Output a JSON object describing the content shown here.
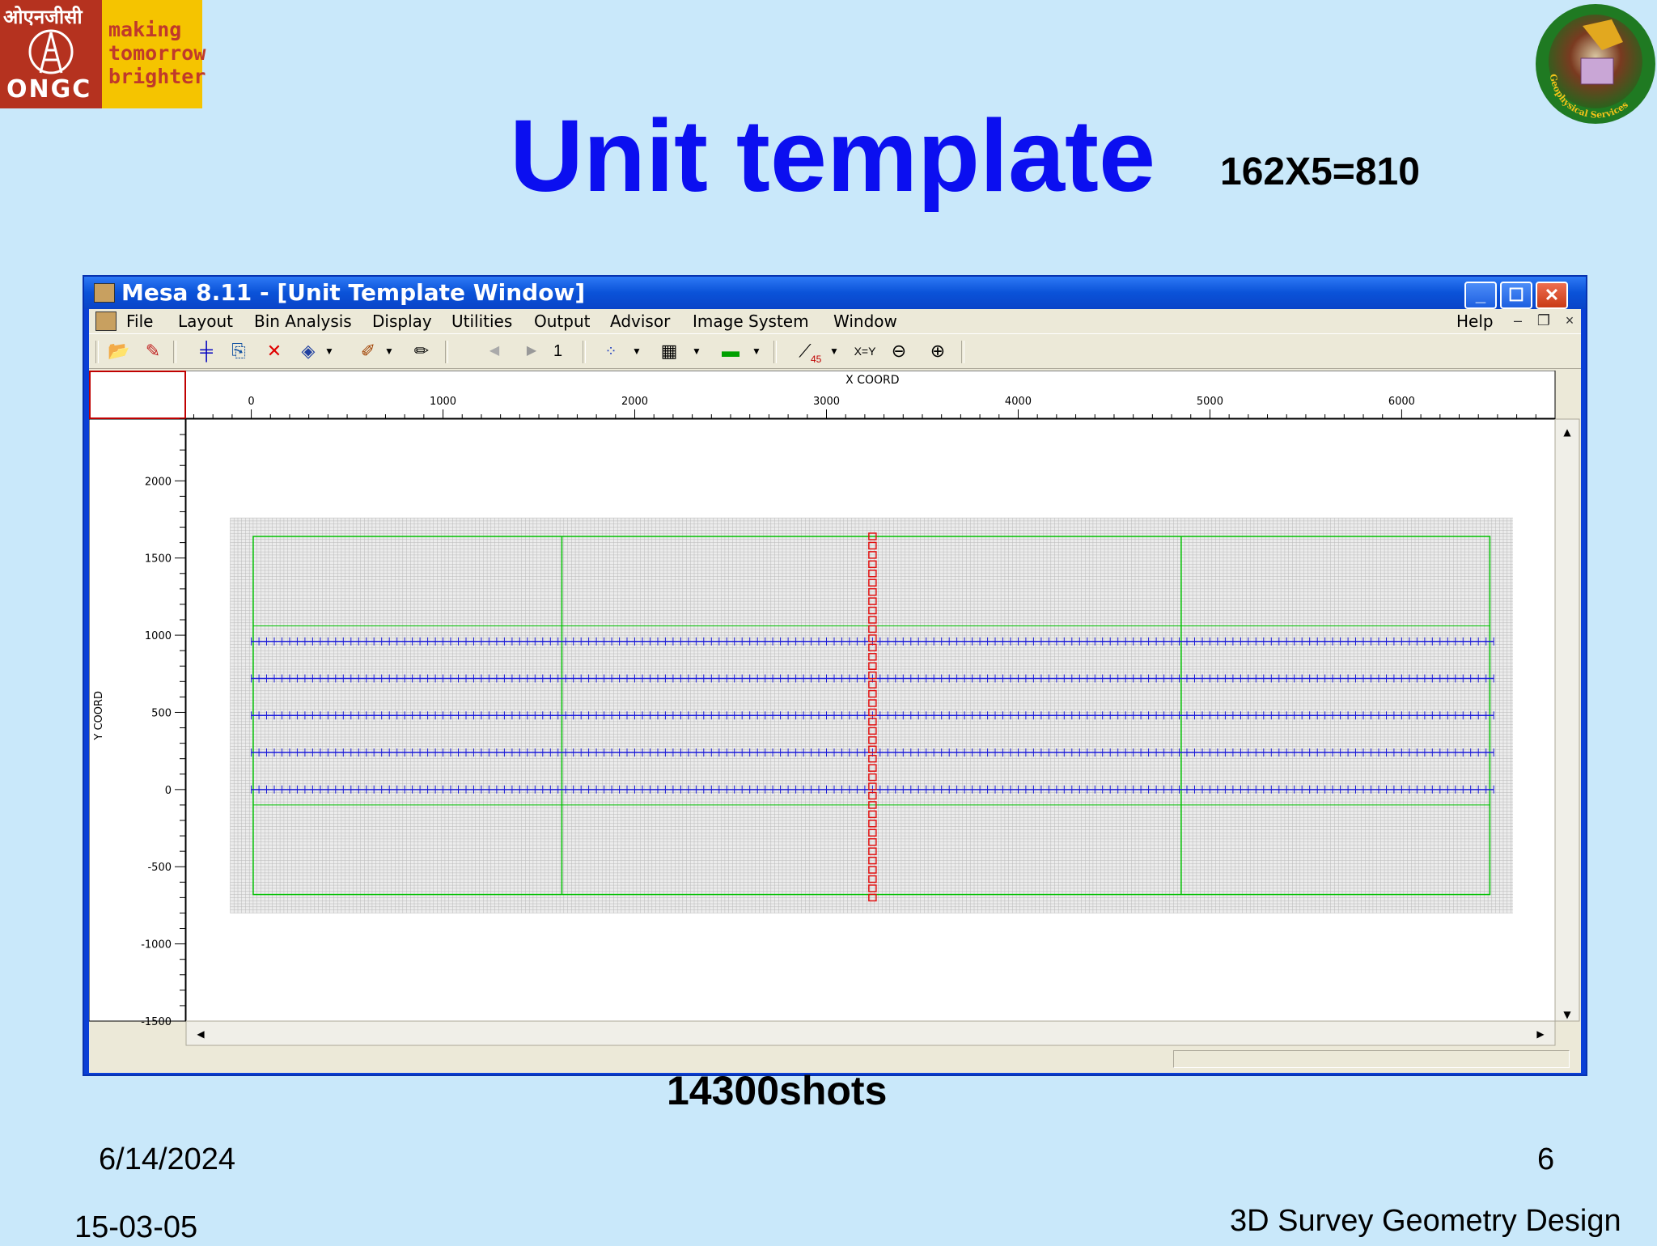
{
  "slide": {
    "title": "Unit template",
    "formula": "162X5=810",
    "shots": "14300shots",
    "date_top": "6/14/2024",
    "page_number": "6",
    "date_bottom": "15-03-05",
    "footer_title": "3D Survey Geometry Design"
  },
  "logos": {
    "ongc_hindi": "ओएनजीसी",
    "ongc_word": "ONGC",
    "tagline": [
      "making",
      "tomorrow",
      "brighter"
    ],
    "gs_text": "Geophysical Services"
  },
  "window": {
    "title": "Mesa 8.11 - [Unit Template Window]",
    "caption_buttons": [
      "minimize-icon",
      "maximize-icon",
      "close-icon"
    ]
  },
  "menu": {
    "items": [
      "File",
      "Layout",
      "Bin Analysis",
      "Display",
      "Utilities",
      "Output",
      "Advisor",
      "Image System",
      "Window"
    ],
    "help": "Help"
  },
  "toolbar": {
    "icons": [
      "open-folder-icon",
      "paint-icon",
      "add-grid-icon",
      "copy-icon",
      "delete-icon",
      "layer-icon",
      "edit-icon",
      "pencil-icon",
      "prev-icon",
      "next-icon",
      "scatter-icon",
      "grid-icon",
      "bins-icon",
      "line-icon",
      "xy-icon",
      "zoom-out-icon",
      "zoom-in-icon"
    ],
    "page": "1",
    "xy_label": "X=Y",
    "angle_label": "45"
  },
  "chart_data": {
    "type": "scatter",
    "xlabel": "X COORD",
    "ylabel": "Y COORD",
    "xlim": [
      -340,
      6800
    ],
    "ylim": [
      -1500,
      2400
    ],
    "xticks": [
      0,
      1000,
      2000,
      3000,
      4000,
      5000,
      6000
    ],
    "yticks": [
      2000,
      1500,
      1000,
      500,
      0,
      -500,
      -1000,
      -1500
    ],
    "receiver_lines": {
      "y": [
        0,
        240,
        480,
        720,
        960
      ],
      "x_range": [
        0,
        6480
      ],
      "station_interval": 40,
      "color": "#1a1ad8"
    },
    "source_line": {
      "x": 3240,
      "y_range": [
        -700,
        1660
      ],
      "interval": 60,
      "color": "#e01010"
    },
    "patch_outline": {
      "x": [
        10,
        1620,
        4850,
        6460
      ],
      "y": [
        -680,
        1640
      ],
      "inner_y": [
        -100,
        1060
      ],
      "color": "#00c000"
    },
    "bin_grid_extent": {
      "x": [
        -110,
        6580
      ],
      "y": [
        -800,
        1760
      ],
      "color": "#b8b8b8"
    }
  }
}
